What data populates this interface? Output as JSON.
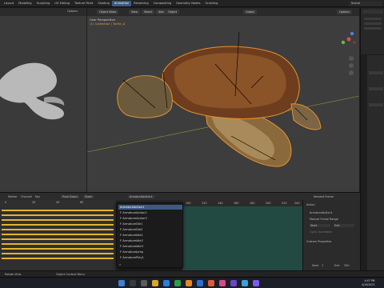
{
  "topbar": {
    "menus": [
      "Layout",
      "Modeling",
      "Sculpting",
      "UV Editing",
      "Texture Paint",
      "Shading",
      "Animation",
      "Rendering",
      "Compositing",
      "Geometry Nodes",
      "Scripting"
    ],
    "active_menu": "Animation",
    "scene": "Scene"
  },
  "left_viewport": {
    "options_label": "Options"
  },
  "main_viewport": {
    "mode": "Object Mode",
    "view": "View",
    "select": "Select",
    "add": "Add",
    "object": "Object",
    "global": "Global",
    "options_label": "Options",
    "info_title": "User Perspective",
    "info_sub": "(1) Collection | Turtle_A"
  },
  "dopesheet": {
    "marker": "Marker",
    "channel": "Channel",
    "key": "Key",
    "push_down": "Push Down",
    "stash": "Stash",
    "frames": [
      "0",
      "20",
      "40",
      "60"
    ]
  },
  "action_selector": {
    "value": "ArmatureAction1"
  },
  "dropdown": {
    "items": [
      "ArmatureAction1",
      "F ArmatureAction2",
      "F ArmatureAction3",
      "F ArmatureDie1",
      "F ArmatureDie2",
      "F ArmatureIdle1",
      "F ArmatureIdle2",
      "F ArmatureIdle3",
      "F ArmatureJump",
      "F ArmaturePlay1"
    ],
    "selected_index": 0
  },
  "timeline_ruler": [
    "100",
    "120",
    "140",
    "160",
    "180",
    "200",
    "220",
    "240"
  ],
  "nearest_frame": "Nearest Frame",
  "action_panel": {
    "title": "Action",
    "action_name": "ArmatureAction1",
    "manual_range": "Manual Frame Range",
    "start_label": "Start",
    "end_label": "End",
    "cyclic_label": "Cyclic Animation",
    "custom_props": "Custom Properties"
  },
  "playback": {
    "start_label": "Start",
    "start": "1",
    "end_label": "End",
    "end": "250"
  },
  "statusbar": {
    "left": "Rotate View",
    "middle": "Object Context Menu"
  },
  "taskbar": {
    "time": "4:47 PM",
    "date": "4/19/2023"
  }
}
